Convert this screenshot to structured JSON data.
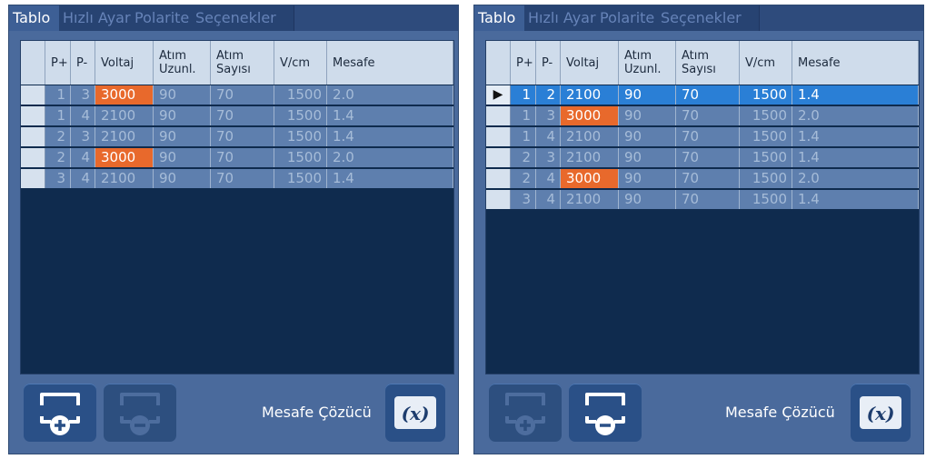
{
  "tabs": [
    "Tablo",
    "Hızlı Ayar",
    "Polarite",
    "Seçenekler"
  ],
  "columns": {
    "p_plus": "P+",
    "p_minus": "P-",
    "voltage": "Voltaj",
    "pulse_length": "Atım Uzunl.",
    "pulse_count": "Atım Sayısı",
    "vcm": "V/cm",
    "distance": "Mesafe"
  },
  "left_table": [
    {
      "p_plus": "1",
      "p_minus": "3",
      "voltage": "3000",
      "pulse_length": "90",
      "pulse_count": "70",
      "vcm": "1500",
      "distance": "2.0",
      "highlight": true
    },
    {
      "p_plus": "1",
      "p_minus": "4",
      "voltage": "2100",
      "pulse_length": "90",
      "pulse_count": "70",
      "vcm": "1500",
      "distance": "1.4",
      "highlight": false
    },
    {
      "p_plus": "2",
      "p_minus": "3",
      "voltage": "2100",
      "pulse_length": "90",
      "pulse_count": "70",
      "vcm": "1500",
      "distance": "1.4",
      "highlight": false
    },
    {
      "p_plus": "2",
      "p_minus": "4",
      "voltage": "3000",
      "pulse_length": "90",
      "pulse_count": "70",
      "vcm": "1500",
      "distance": "2.0",
      "highlight": true
    },
    {
      "p_plus": "3",
      "p_minus": "4",
      "voltage": "2100",
      "pulse_length": "90",
      "pulse_count": "70",
      "vcm": "1500",
      "distance": "1.4",
      "highlight": false
    }
  ],
  "right_table": [
    {
      "selected": true,
      "p_plus": "1",
      "p_minus": "2",
      "voltage": "2100",
      "pulse_length": "90",
      "pulse_count": "70",
      "vcm": "1500",
      "distance": "1.4",
      "highlight": false
    },
    {
      "selected": false,
      "p_plus": "1",
      "p_minus": "3",
      "voltage": "3000",
      "pulse_length": "90",
      "pulse_count": "70",
      "vcm": "1500",
      "distance": "2.0",
      "highlight": true
    },
    {
      "selected": false,
      "p_plus": "1",
      "p_minus": "4",
      "voltage": "2100",
      "pulse_length": "90",
      "pulse_count": "70",
      "vcm": "1500",
      "distance": "1.4",
      "highlight": false
    },
    {
      "selected": false,
      "p_plus": "2",
      "p_minus": "3",
      "voltage": "2100",
      "pulse_length": "90",
      "pulse_count": "70",
      "vcm": "1500",
      "distance": "1.4",
      "highlight": false
    },
    {
      "selected": false,
      "p_plus": "2",
      "p_minus": "4",
      "voltage": "3000",
      "pulse_length": "90",
      "pulse_count": "70",
      "vcm": "1500",
      "distance": "2.0",
      "highlight": true
    },
    {
      "selected": false,
      "p_plus": "3",
      "p_minus": "4",
      "voltage": "2100",
      "pulse_length": "90",
      "pulse_count": "70",
      "vcm": "1500",
      "distance": "1.4",
      "highlight": false
    }
  ],
  "selected_row_marker": "▶",
  "resolver_label": "Mesafe Çözücü",
  "left_panel": {
    "add_enabled": true,
    "remove_enabled": false
  },
  "right_panel": {
    "add_enabled": false,
    "remove_enabled": true
  },
  "icons": {
    "add": "add-row-icon",
    "remove": "remove-row-icon",
    "resolver": "formula-x-icon"
  },
  "colors": {
    "panel": "#4a6a9c",
    "table_bg": "#0f2b4e",
    "row": "#5e7fae",
    "selected_row": "#2a7fd6",
    "highlight": "#e8692c"
  }
}
